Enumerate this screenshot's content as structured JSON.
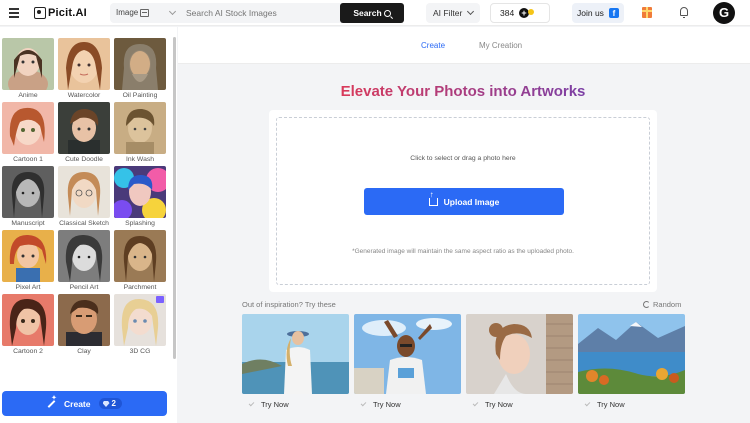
{
  "header": {
    "logo_text": "Picit.AI",
    "search_type": "Image",
    "search_placeholder": "Search AI Stock Images",
    "search_button": "Search",
    "ai_filter": "AI Filter",
    "credits": "384",
    "join_label": "Join us",
    "avatar_letter": "G",
    "accent": "#2b6af5"
  },
  "sidebar": {
    "styles": [
      {
        "label": "Anime"
      },
      {
        "label": "Watercolor"
      },
      {
        "label": "Oil Painting"
      },
      {
        "label": "Cartoon 1"
      },
      {
        "label": "Cute Doodle"
      },
      {
        "label": "Ink Wash"
      },
      {
        "label": "Manuscript"
      },
      {
        "label": "Classical Sketch"
      },
      {
        "label": "Splashing"
      },
      {
        "label": "Pixel Art"
      },
      {
        "label": "Pencil Art"
      },
      {
        "label": "Parchment"
      },
      {
        "label": "Cartoon 2"
      },
      {
        "label": "Clay"
      },
      {
        "label": "3D CG"
      }
    ],
    "create_label": "Create",
    "create_cost": "2"
  },
  "tabs": [
    {
      "label": "Create",
      "active": true
    },
    {
      "label": "My Creation",
      "active": false
    }
  ],
  "main": {
    "title": "Elevate Your Photos into Artworks",
    "drop_hint": "Click to select or drag a photo here",
    "upload_button": "Upload Image",
    "aspect_note": "*Generated image will maintain the same aspect ratio as the uploaded photo.",
    "inspiration_label": "Out of inspiration?  Try these",
    "random_label": "Random",
    "samples": [
      {
        "try_label": "Try Now"
      },
      {
        "try_label": "Try Now"
      },
      {
        "try_label": "Try Now"
      },
      {
        "try_label": "Try Now"
      }
    ]
  }
}
